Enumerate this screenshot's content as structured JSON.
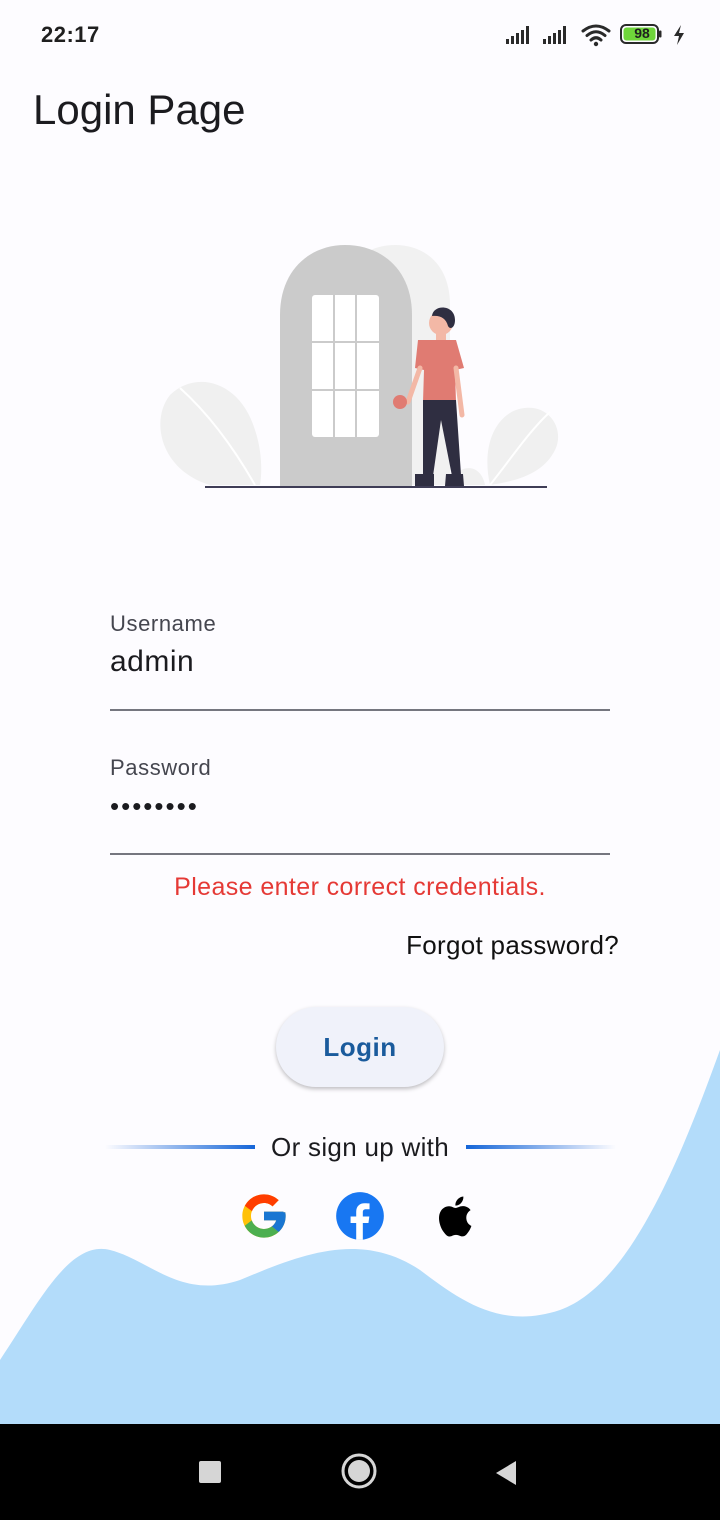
{
  "status_bar": {
    "time": "22:17",
    "battery_level": "98",
    "icons": [
      "signal-icon",
      "signal-icon",
      "wifi-icon",
      "battery-icon",
      "charging-icon"
    ]
  },
  "page": {
    "title": "Login Page"
  },
  "form": {
    "username": {
      "label": "Username",
      "value": "admin"
    },
    "password": {
      "label": "Password",
      "value": "••••••••"
    },
    "error_message": "Please enter correct credentials.",
    "forgot_password_label": "Forgot password?",
    "login_button_label": "Login"
  },
  "social": {
    "divider_text": "Or sign up with",
    "providers": [
      "google-icon",
      "facebook-icon",
      "apple-icon"
    ]
  },
  "nav_bar": {
    "buttons": [
      "recents-button",
      "home-button",
      "back-button"
    ]
  },
  "colors": {
    "background": "#fdfcff",
    "accent": "#1a5b9c",
    "error": "#e53935",
    "wave": "#b3dcfa",
    "divider_blue": "#1565d8"
  }
}
